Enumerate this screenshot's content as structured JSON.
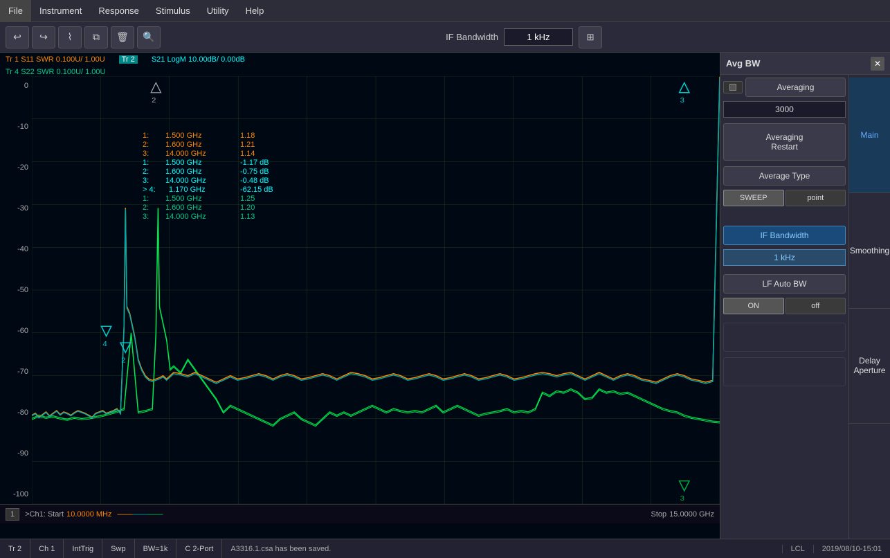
{
  "menubar": {
    "items": [
      "File",
      "Instrument",
      "Response",
      "Stimulus",
      "Utility",
      "Help"
    ]
  },
  "toolbar": {
    "buttons": [
      "↩",
      "↪",
      "⌇",
      "⧉",
      "🗑",
      "🔍"
    ],
    "if_bandwidth_label": "IF Bandwidth",
    "if_bandwidth_value": "1 kHz"
  },
  "traces": {
    "tr1": "Tr 1  S11 SWR 0.100U/  1.00U",
    "tr2": "Tr 2",
    "tr2_label": "S21 LogM 10.00dB/  0.00dB",
    "tr4": "Tr 4  S22 SWR 0.100U/  1.00U"
  },
  "y_axis": [
    "0",
    "-10",
    "-20",
    "-30",
    "-40",
    "-50",
    "-60",
    "-70",
    "-80",
    "-90",
    "-100"
  ],
  "marker_data": [
    {
      "idx": "1:",
      "freq": "1.500 GHz",
      "val": "1.18",
      "color": "orange"
    },
    {
      "idx": "2:",
      "freq": "1.600 GHz",
      "val": "1.21",
      "color": "orange"
    },
    {
      "idx": "3:",
      "freq": "14.000 GHz",
      "val": "1.14",
      "color": "orange"
    },
    {
      "idx": "1:",
      "freq": "1.500 GHz",
      "val": "-1.17 dB",
      "color": "cyan"
    },
    {
      "idx": "2:",
      "freq": "1.600 GHz",
      "val": "-0.75 dB",
      "color": "cyan"
    },
    {
      "idx": "3:",
      "freq": "14.000 GHz",
      "val": "-0.48 dB",
      "color": "cyan"
    },
    {
      "idx": "> 4:",
      "freq": "1.170 GHz",
      "val": "-62.15 dB",
      "color": "cyan"
    },
    {
      "idx": "1:",
      "freq": "1.500 GHz",
      "val": "1.25",
      "color": "green"
    },
    {
      "idx": "2:",
      "freq": "1.600 GHz",
      "val": "1.20",
      "color": "green"
    },
    {
      "idx": "3:",
      "freq": "14.000 GHz",
      "val": "1.13",
      "color": "green"
    }
  ],
  "chart_bottom": {
    "ch_num": "1",
    "ch_label": ">Ch1:  Start",
    "start_freq": "10.0000 MHz",
    "stop_label": "Stop",
    "stop_freq": "15.0000 GHz"
  },
  "panel": {
    "title": "Avg BW",
    "close_label": "✕",
    "averaging_label": "Averaging",
    "averaging_value": "3000",
    "averaging_restart_label": "Averaging\nRestart",
    "average_type_label": "Average Type",
    "sweep_label": "SWEEP",
    "point_label": "point",
    "if_bandwidth_label": "IF Bandwidth",
    "if_bandwidth_value": "1 kHz",
    "lf_auto_bw_label": "LF Auto BW",
    "lf_on_label": "ON",
    "lf_off_label": "off",
    "right_buttons": [
      "Main",
      "Smoothing",
      "Delay\nAperture"
    ]
  },
  "statusbar": {
    "tr2": "Tr 2",
    "ch1": "Ch 1",
    "int_trig": "IntTrig",
    "swp": "Swp",
    "bw": "BW=1k",
    "port": "C  2-Port",
    "message": "A3316.1.csa has been saved.",
    "lcl": "LCL",
    "datetime": "2019/08/10-15:01"
  }
}
